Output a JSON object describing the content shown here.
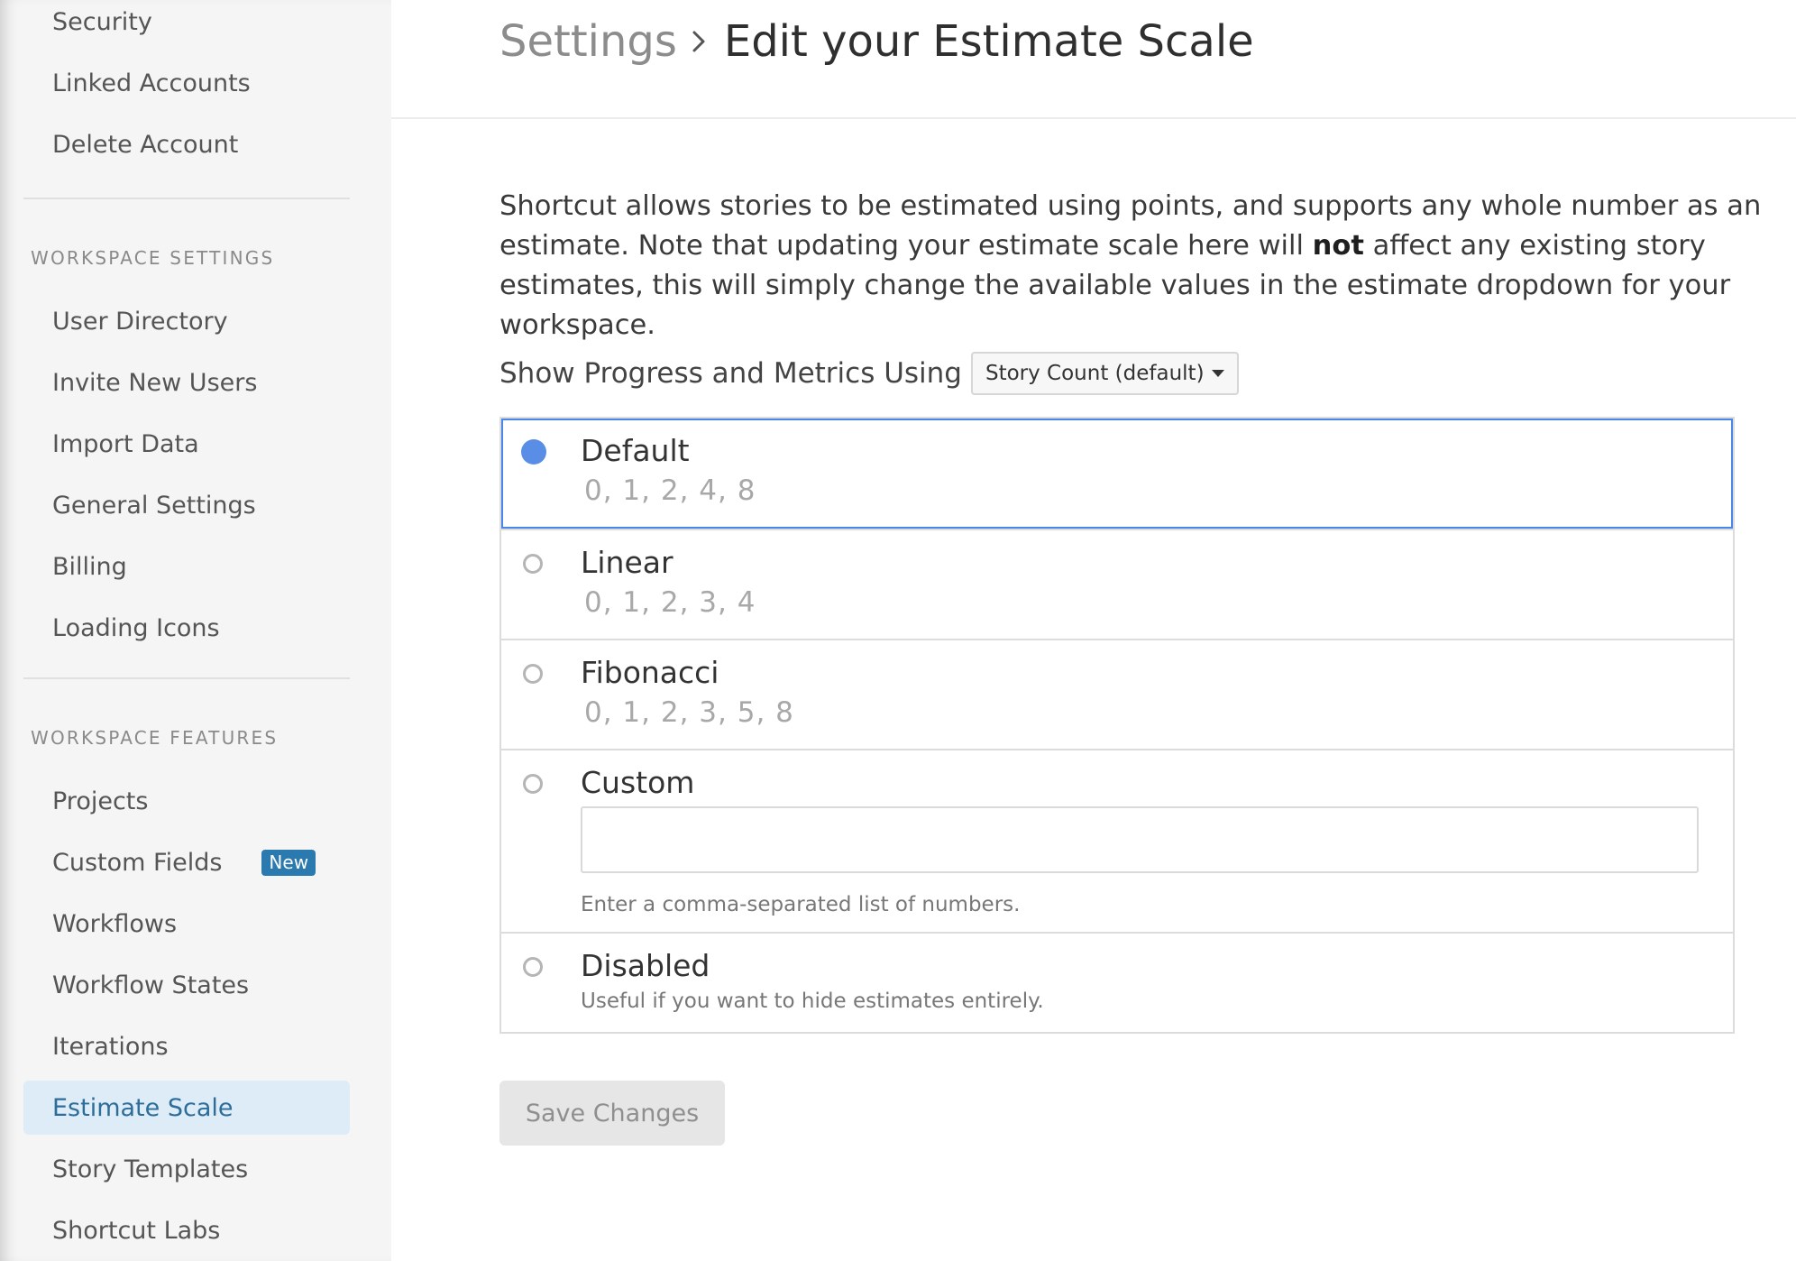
{
  "sidebar": {
    "account_items": [
      {
        "label": "Security"
      },
      {
        "label": "Linked Accounts"
      },
      {
        "label": "Delete Account"
      }
    ],
    "workspace_settings": {
      "header": "WORKSPACE SETTINGS",
      "items": [
        {
          "label": "User Directory"
        },
        {
          "label": "Invite New Users"
        },
        {
          "label": "Import Data"
        },
        {
          "label": "General Settings"
        },
        {
          "label": "Billing"
        },
        {
          "label": "Loading Icons"
        }
      ]
    },
    "workspace_features": {
      "header": "WORKSPACE FEATURES",
      "items": [
        {
          "label": "Projects"
        },
        {
          "label": "Custom Fields",
          "badge": "New"
        },
        {
          "label": "Workflows"
        },
        {
          "label": "Workflow States"
        },
        {
          "label": "Iterations"
        },
        {
          "label": "Estimate Scale",
          "active": true
        },
        {
          "label": "Story Templates"
        },
        {
          "label": "Shortcut Labs"
        }
      ]
    }
  },
  "header": {
    "breadcrumb_parent": "Settings",
    "title": "Edit your Estimate Scale"
  },
  "description": {
    "part1": "Shortcut allows stories to be estimated using points, and supports any whole number as an estimate. Note that updating your estimate scale here will ",
    "bold": "not",
    "part2": " affect any existing story estimates, this will simply change the available values in the estimate dropdown for your workspace."
  },
  "metrics": {
    "label": "Show Progress and Metrics Using",
    "selected": "Story Count (default)"
  },
  "options": [
    {
      "label": "Default",
      "values": "0, 1, 2, 4, 8",
      "selected": true
    },
    {
      "label": "Linear",
      "values": "0, 1, 2, 3, 4",
      "selected": false
    },
    {
      "label": "Fibonacci",
      "values": "0, 1, 2, 3, 5, 8",
      "selected": false
    },
    {
      "label": "Custom",
      "input_value": "",
      "help": "Enter a comma-separated list of numbers.",
      "selected": false
    },
    {
      "label": "Disabled",
      "help": "Useful if you want to hide estimates entirely.",
      "selected": false
    }
  ],
  "save_label": "Save Changes",
  "colors": {
    "accent": "#4a86e8",
    "radio_selected": "#5a8ee6",
    "active_nav_bg": "#deecf7",
    "active_nav_text": "#2d6d9a",
    "badge_bg": "#2a7ab0"
  },
  "icons": {
    "breadcrumb_separator": "chevron-right-icon",
    "dropdown": "caret-down-icon"
  }
}
